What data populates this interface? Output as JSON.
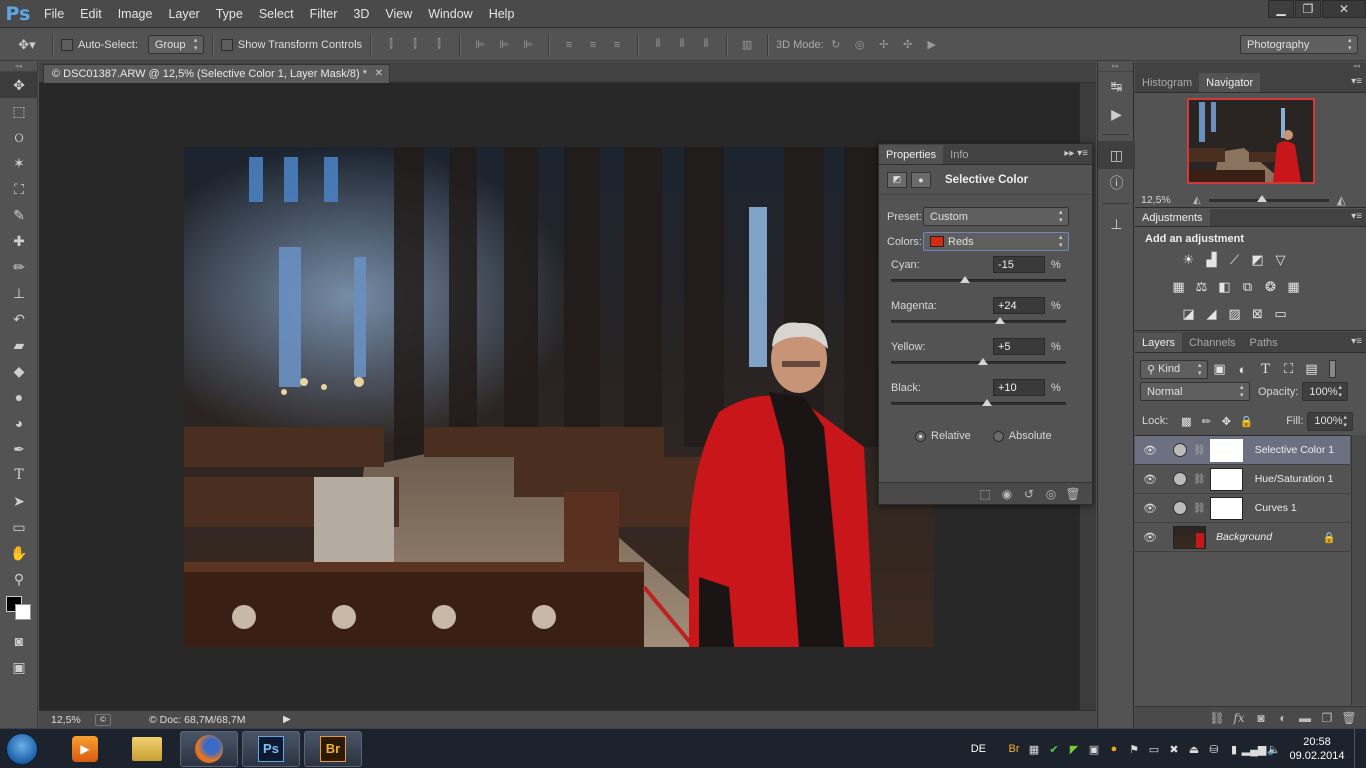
{
  "app": {
    "logo": "Ps",
    "menu": [
      "File",
      "Edit",
      "Image",
      "Layer",
      "Type",
      "Select",
      "Filter",
      "3D",
      "View",
      "Window",
      "Help"
    ],
    "window_controls": {
      "minimize": "▁",
      "restore": "❐",
      "close": "✕"
    }
  },
  "options_bar": {
    "auto_select_label": "Auto-Select:",
    "auto_select_value": "Group",
    "show_transform_label": "Show Transform Controls",
    "mode_3d_label": "3D Mode:",
    "workspace": "Photography"
  },
  "document": {
    "tab_title": "© DSC01387.ARW @ 12,5% (Selective Color 1, Layer Mask/8) *",
    "status_zoom": "12,5%",
    "status_doc": "© Doc: 68,7M/68,7M"
  },
  "properties": {
    "tabs": [
      "Properties",
      "Info"
    ],
    "title": "Selective Color",
    "preset_label": "Preset:",
    "preset_value": "Custom",
    "colors_label": "Colors:",
    "colors_value": "Reds",
    "colors_swatch": "#d42a10",
    "sliders": [
      {
        "label": "Cyan:",
        "value": "-15",
        "unit": "%",
        "fraction": 0.425
      },
      {
        "label": "Magenta:",
        "value": "+24",
        "unit": "%",
        "fraction": 0.62
      },
      {
        "label": "Yellow:",
        "value": "+5",
        "unit": "%",
        "fraction": 0.525
      },
      {
        "label": "Black:",
        "value": "+10",
        "unit": "%",
        "fraction": 0.55
      }
    ],
    "method_relative": "Relative",
    "method_absolute": "Absolute"
  },
  "navigator": {
    "tabs": [
      "Histogram",
      "Navigator"
    ],
    "zoom": "12,5%",
    "zoom_fraction": 0.44
  },
  "adjustments": {
    "title": "Adjustments",
    "subtitle": "Add an adjustment"
  },
  "layers": {
    "tabs": [
      "Layers",
      "Channels",
      "Paths"
    ],
    "kind_label": "Kind",
    "blend_mode": "Normal",
    "opacity_label": "Opacity:",
    "opacity_value": "100%",
    "lock_label": "Lock:",
    "fill_label": "Fill:",
    "fill_value": "100%",
    "items": [
      {
        "name": "Selective Color 1"
      },
      {
        "name": "Hue/Saturation 1"
      },
      {
        "name": "Curves 1"
      },
      {
        "name": "Background"
      }
    ]
  },
  "taskbar": {
    "language": "DE",
    "time": "20:58",
    "date": "09.02.2014",
    "apps": [
      "Ps",
      "Br"
    ]
  }
}
